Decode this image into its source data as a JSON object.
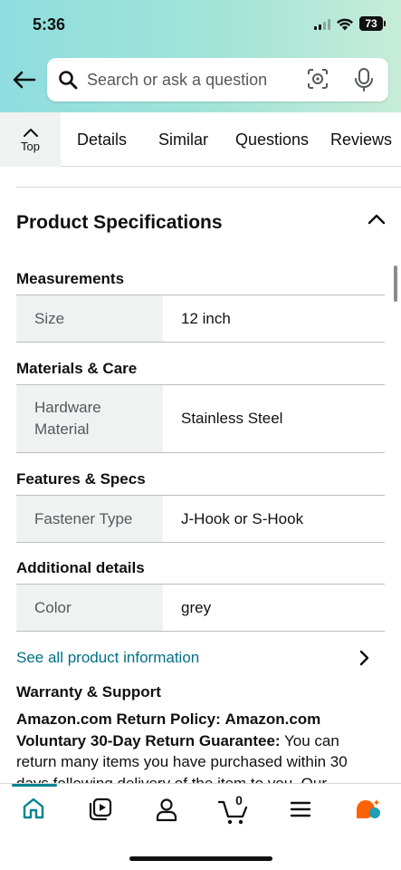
{
  "status": {
    "time": "5:36",
    "battery": "73"
  },
  "search": {
    "placeholder": "Search or ask a question"
  },
  "tabs": {
    "top_label": "Top",
    "items": [
      "Details",
      "Similar",
      "Questions",
      "Reviews"
    ]
  },
  "specs": {
    "title": "Product Specifications",
    "sections": [
      {
        "heading": "Measurements",
        "rows": [
          {
            "key": "Size",
            "value": "12 inch"
          }
        ]
      },
      {
        "heading": "Materials & Care",
        "rows": [
          {
            "key": "Hardware Material",
            "value": "Stainless Steel"
          }
        ]
      },
      {
        "heading": "Features & Specs",
        "rows": [
          {
            "key": "Fastener Type",
            "value": "J-Hook or S-Hook"
          }
        ]
      },
      {
        "heading": "Additional details",
        "rows": [
          {
            "key": "Color",
            "value": "grey"
          }
        ]
      }
    ]
  },
  "see_all": "See all product information",
  "warranty": {
    "title": "Warranty & Support",
    "policy_label": "Amazon.com Return Policy:",
    "guarantee_label": "Amazon.com Voluntary 30-Day Return Guarantee:",
    "body": " You can return many items you have purchased within 30 days following delivery of the item to you. Our"
  },
  "bottom_nav": {
    "cart_count": "0"
  },
  "colors": {
    "accent_teal": "#007185",
    "home_active": "#008296",
    "assistant_orange": "#ff6200",
    "assistant_teal": "#1e9fb4"
  }
}
